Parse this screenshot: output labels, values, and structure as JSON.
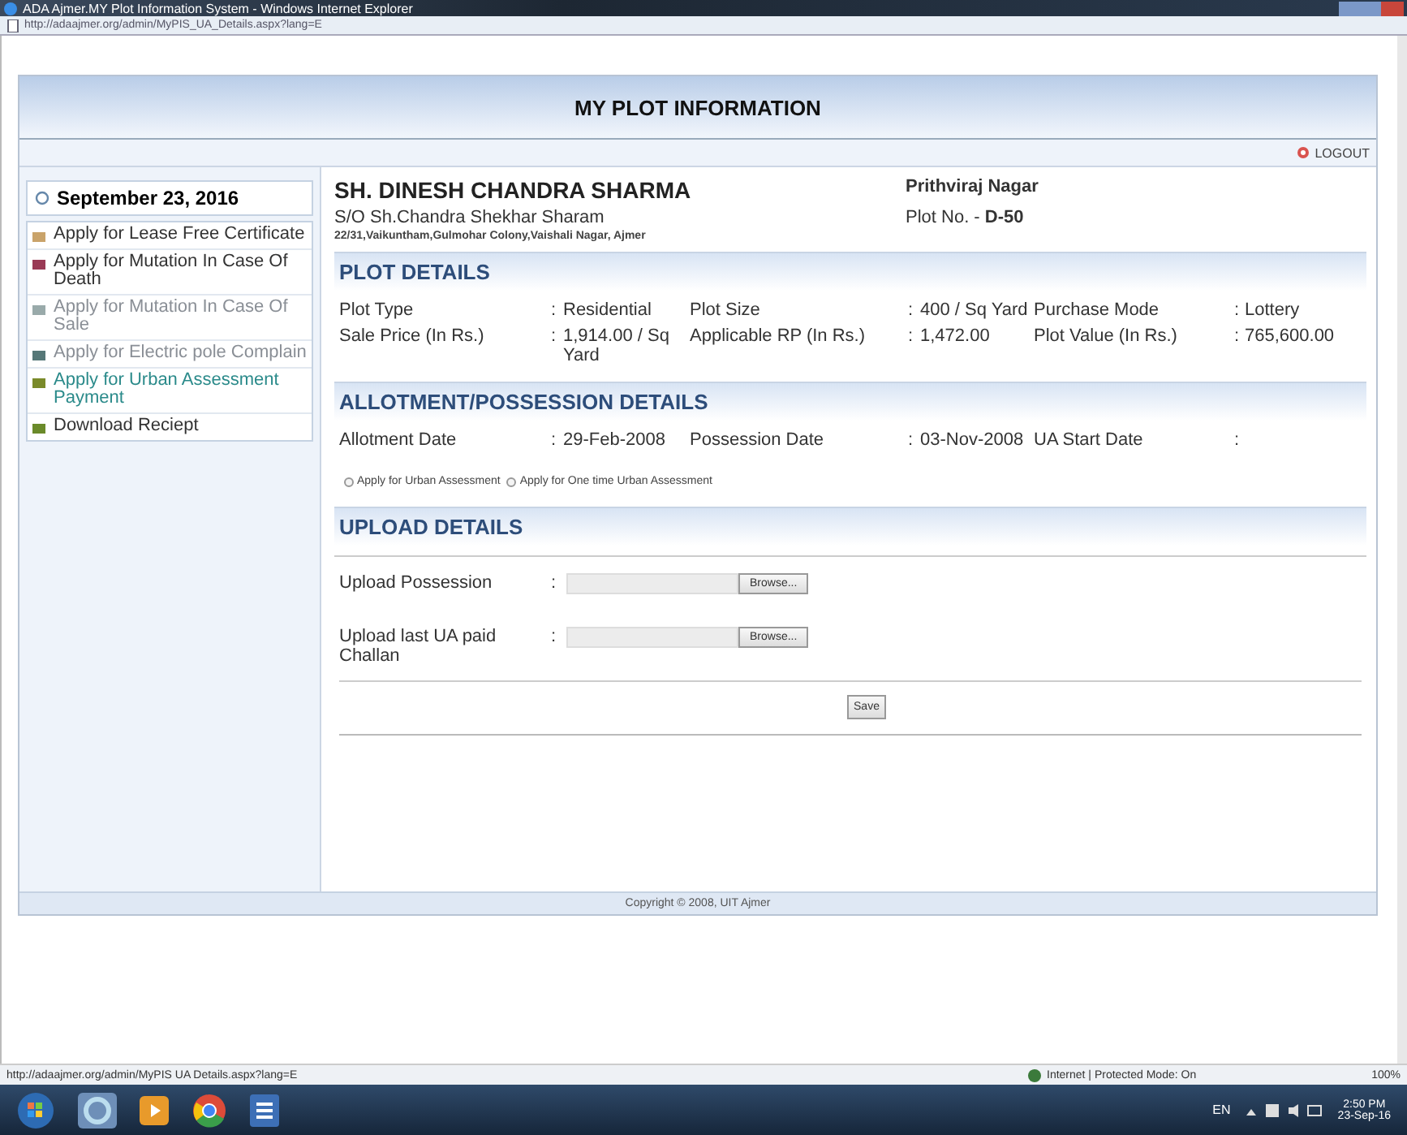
{
  "window": {
    "title": "ADA Ajmer.MY Plot Information System - Windows Internet Explorer",
    "address": "http://adaajmer.org/admin/MyPIS_UA_Details.aspx?lang=E"
  },
  "header": {
    "title": "MY PLOT INFORMATION",
    "logout": "LOGOUT"
  },
  "sidebar": {
    "date": "September 23, 2016",
    "items": [
      {
        "label": "Apply for Lease Free Certificate",
        "selected": false,
        "disabled": false
      },
      {
        "label": "Apply for Mutation In Case Of Death",
        "selected": false,
        "disabled": false
      },
      {
        "label": "Apply for Mutation In Case Of Sale",
        "selected": false,
        "disabled": true
      },
      {
        "label": "Apply for Electric pole Complain",
        "selected": false,
        "disabled": true
      },
      {
        "label": "Apply for Urban Assessment Payment",
        "selected": true,
        "disabled": false
      },
      {
        "label": "Download Reciept",
        "selected": false,
        "disabled": false
      }
    ]
  },
  "profile": {
    "name": "SH. DINESH CHANDRA SHARMA",
    "relation": "S/O Sh.Chandra Shekhar Sharam",
    "address": "22/31,Vaikuntham,Gulmohar Colony,Vaishali Nagar, Ajmer",
    "area": "Prithviraj Nagar",
    "plot_no": "Plot No. - **D-50**"
  },
  "plot_details": {
    "title": "PLOT DETAILS",
    "fields": [
      {
        "label": "Plot Type",
        "separator": ":",
        "value": "Residential"
      },
      {
        "label": "Plot Size",
        "separator": ":",
        "value": "400 / Sq Yard"
      },
      {
        "label": "Purchase Mode",
        "separator": ":",
        "value": "Lottery"
      },
      {
        "label": "Sale Price (In Rs.)",
        "separator": ":",
        "value": "1,914.00 / Sq Yard"
      },
      {
        "label": "Applicable RP (In Rs.)",
        "separator": ":",
        "value": "1,472.00"
      },
      {
        "label": "Plot Value (In Rs.)",
        "separator": ":",
        "value": "765,600.00"
      }
    ]
  },
  "allotment": {
    "title": "ALLOTMENT/POSSESSION DETAILS",
    "fields": [
      {
        "label": "Allotment Date",
        "separator": ":",
        "value": "29-Feb-2008"
      },
      {
        "label": "Possession Date",
        "separator": ":",
        "value": "03-Nov-2008"
      },
      {
        "label": "UA Start Date",
        "separator": ":"
      }
    ]
  },
  "options": [
    {
      "label": "Apply for Urban Assessment",
      "selected": false
    },
    {
      "label": "Apply for One time Urban Assessment",
      "selected": false
    }
  ],
  "upload": {
    "title": "UPLOAD DETAILS",
    "rows": [
      {
        "label": "Upload Possession",
        "separator": ":",
        "button": "Browse..."
      },
      {
        "label": "Upload last UA paid Challan",
        "separator": ":",
        "button": "Browse..."
      }
    ],
    "save": "Save"
  },
  "footer": "Copyright © 2008, UIT Ajmer",
  "status_bar": {
    "url": "http://adaajmer.org/admin/MyPIS UA Details.aspx?lang=E",
    "zone": "Internet | Protected Mode: On",
    "zoom": "100%"
  },
  "taskbar": {
    "lang": "EN",
    "time": "2:50 PM",
    "date": "23-Sep-16"
  }
}
